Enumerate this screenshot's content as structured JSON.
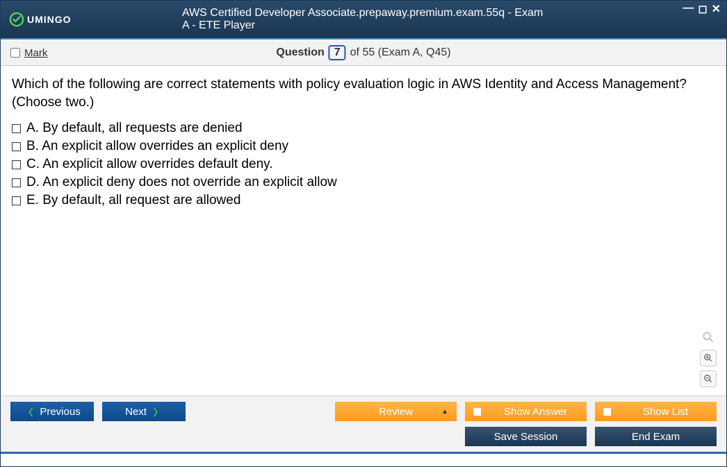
{
  "window": {
    "title": "AWS Certified Developer Associate.prepaway.premium.exam.55q - Exam A - ETE Player",
    "logo_text": "UMINGO"
  },
  "mark": {
    "label": "Mark",
    "checked": false
  },
  "question_bar": {
    "label": "Question",
    "number": "7",
    "suffix": "of 55 (Exam A, Q45)"
  },
  "question": {
    "text": "Which of the following are correct statements with policy evaluation logic in AWS Identity and Access Management? (Choose two.)",
    "choices": [
      {
        "letter": "A.",
        "text": "By default, all requests are denied"
      },
      {
        "letter": "B.",
        "text": "An explicit allow overrides an explicit deny"
      },
      {
        "letter": "C.",
        "text": "An explicit allow overrides default deny."
      },
      {
        "letter": "D.",
        "text": "An explicit deny does not override an explicit allow"
      },
      {
        "letter": "E.",
        "text": "By default, all request are allowed"
      }
    ]
  },
  "buttons": {
    "previous": "Previous",
    "next": "Next",
    "review": "Review",
    "show_answer": "Show Answer",
    "show_list": "Show List",
    "save_session": "Save Session",
    "end_exam": "End Exam"
  }
}
